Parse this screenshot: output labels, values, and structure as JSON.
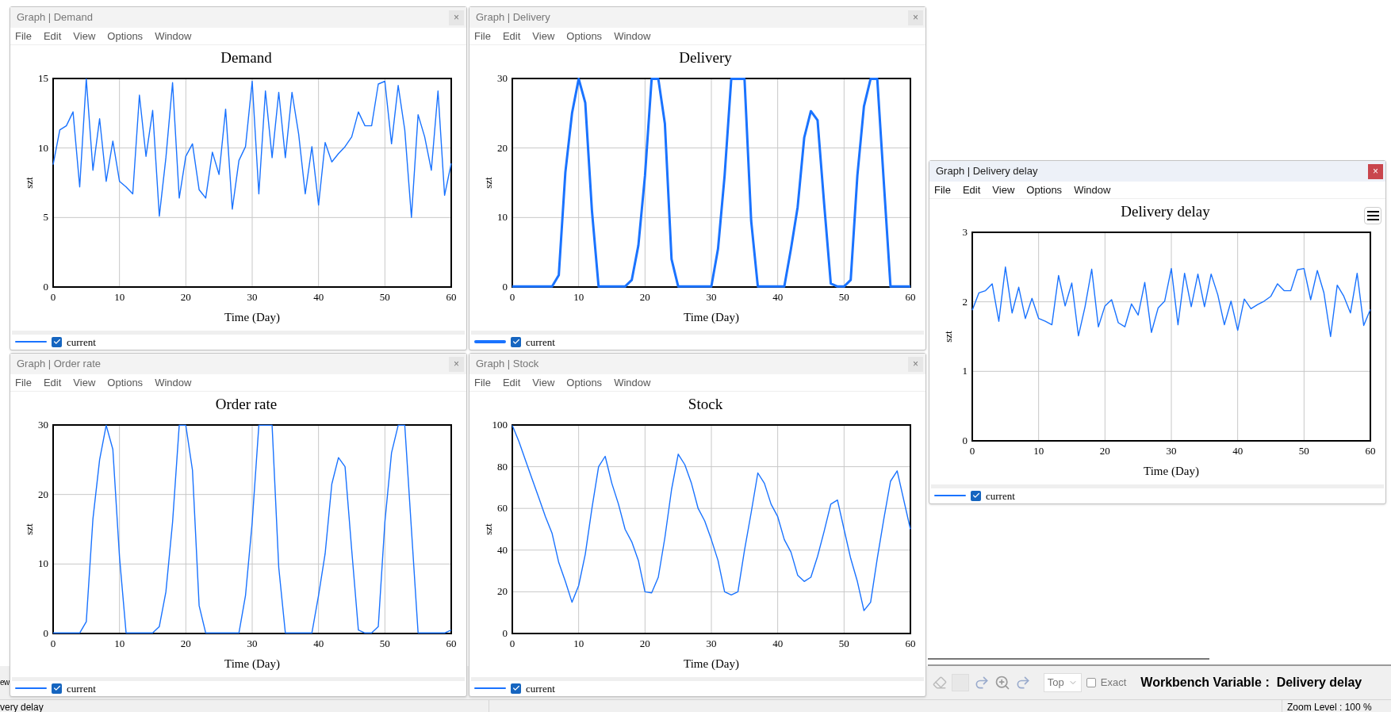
{
  "windows": [
    {
      "title": "Graph | Demand",
      "active": false,
      "close": "×",
      "menu": [
        "File",
        "Edit",
        "View",
        "Options",
        "Window"
      ],
      "thick_line": false,
      "chart_menu": false,
      "legend": {
        "checked": true
      },
      "chart_data": {
        "type": "line",
        "grid": true,
        "title": "Demand",
        "xlabel": "Time (Day)",
        "ylabel": "szt",
        "xlim": [
          0,
          60
        ],
        "ylim": [
          0,
          15
        ],
        "xticks": [
          0,
          10,
          20,
          30,
          40,
          50,
          60
        ],
        "yticks": [
          0,
          5,
          10,
          15
        ],
        "x": [
          0,
          1,
          2,
          3,
          4,
          5,
          6,
          7,
          8,
          9,
          10,
          11,
          12,
          13,
          14,
          15,
          16,
          17,
          18,
          19,
          20,
          21,
          22,
          23,
          24,
          25,
          26,
          27,
          28,
          29,
          30,
          31,
          32,
          33,
          34,
          35,
          36,
          37,
          38,
          39,
          40,
          41,
          42,
          43,
          44,
          45,
          46,
          47,
          48,
          49,
          50,
          51,
          52,
          53,
          54,
          55,
          56,
          57,
          58,
          59,
          60
        ],
        "series": [
          {
            "name": "current",
            "color": "#1a73ff",
            "values": [
              8.8,
              11.3,
              11.6,
              12.6,
              7.2,
              15,
              8.4,
              12.1,
              7.6,
              10.5,
              7.6,
              7.2,
              6.7,
              13.8,
              9.4,
              12.7,
              5.1,
              9.3,
              14.7,
              6.4,
              9.4,
              10.3,
              7.0,
              6.4,
              9.7,
              8.1,
              12.8,
              5.6,
              9.1,
              10.1,
              14.8,
              6.7,
              14.1,
              9.3,
              14.0,
              9.3,
              14.0,
              11.0,
              6.7,
              10.1,
              5.9,
              10.4,
              9.0,
              9.6,
              10.1,
              10.8,
              12.6,
              11.6,
              11.6,
              14.6,
              14.8,
              10.3,
              14.5,
              11.3,
              5.0,
              12.4,
              10.8,
              8.4,
              14.1,
              6.6,
              8.9
            ]
          }
        ]
      }
    },
    {
      "title": "Graph | Delivery",
      "active": false,
      "close": "×",
      "menu": [
        "File",
        "Edit",
        "View",
        "Options",
        "Window"
      ],
      "thick_line": true,
      "chart_menu": false,
      "legend": {
        "checked": true
      },
      "chart_data": {
        "type": "line",
        "grid": true,
        "title": "Delivery",
        "xlabel": "Time (Day)",
        "ylabel": "szt",
        "xlim": [
          0,
          60
        ],
        "ylim": [
          0,
          30
        ],
        "xticks": [
          0,
          10,
          20,
          30,
          40,
          50,
          60
        ],
        "yticks": [
          0,
          10,
          20,
          30
        ],
        "x": [
          0,
          1,
          2,
          3,
          4,
          5,
          6,
          7,
          8,
          9,
          10,
          11,
          12,
          13,
          14,
          15,
          16,
          17,
          18,
          19,
          20,
          21,
          22,
          23,
          24,
          25,
          26,
          27,
          28,
          29,
          30,
          31,
          32,
          33,
          34,
          35,
          36,
          37,
          38,
          39,
          40,
          41,
          42,
          43,
          44,
          45,
          46,
          47,
          48,
          49,
          50,
          51,
          52,
          53,
          54,
          55,
          56,
          57,
          58,
          59,
          60
        ],
        "series": [
          {
            "name": "current",
            "color": "#1a73ff",
            "values": [
              0,
              0,
              0,
              0,
              0,
              0,
              0,
              1.7,
              16.5,
              25,
              30,
              26.5,
              11,
              0,
              0,
              0,
              0,
              0,
              1,
              6,
              16,
              30,
              30,
              23.5,
              4,
              0,
              0,
              0,
              0,
              0,
              0,
              5.5,
              16,
              30,
              30,
              30,
              9.5,
              0,
              0,
              0,
              0,
              0,
              5.5,
              11.5,
              21.5,
              25.3,
              24,
              12,
              0.5,
              0,
              0,
              1,
              16,
              26,
              30,
              30,
              15,
              0,
              0,
              0,
              0
            ]
          }
        ]
      }
    },
    {
      "title": "Graph | Order rate",
      "active": false,
      "close": "×",
      "menu": [
        "File",
        "Edit",
        "View",
        "Options",
        "Window"
      ],
      "thick_line": false,
      "chart_menu": false,
      "legend": {
        "checked": true
      },
      "chart_data": {
        "type": "line",
        "grid": true,
        "title": "Order rate",
        "xlabel": "Time (Day)",
        "ylabel": "szt",
        "xlim": [
          0,
          60
        ],
        "ylim": [
          0,
          30
        ],
        "xticks": [
          0,
          10,
          20,
          30,
          40,
          50,
          60
        ],
        "yticks": [
          0,
          10,
          20,
          30
        ],
        "x": [
          0,
          1,
          2,
          3,
          4,
          5,
          6,
          7,
          8,
          9,
          10,
          11,
          12,
          13,
          14,
          15,
          16,
          17,
          18,
          19,
          20,
          21,
          22,
          23,
          24,
          25,
          26,
          27,
          28,
          29,
          30,
          31,
          32,
          33,
          34,
          35,
          36,
          37,
          38,
          39,
          40,
          41,
          42,
          43,
          44,
          45,
          46,
          47,
          48,
          49,
          50,
          51,
          52,
          53,
          54,
          55,
          56,
          57,
          58,
          59,
          60
        ],
        "series": [
          {
            "name": "current",
            "color": "#1a73ff",
            "values": [
              0,
              0,
              0,
              0,
              0,
              1.7,
              16.5,
              25,
              30,
              26.5,
              11,
              0,
              0,
              0,
              0,
              0,
              1,
              6,
              16,
              30,
              30,
              23.5,
              4,
              0,
              0,
              0,
              0,
              0,
              0,
              5.5,
              16,
              30,
              30,
              30,
              9.5,
              0,
              0,
              0,
              0,
              0,
              5.5,
              11.5,
              21.5,
              25.3,
              24,
              12,
              0.5,
              0,
              0,
              1,
              16,
              26,
              30,
              30,
              15,
              0,
              0,
              0,
              0,
              0,
              0.5
            ]
          }
        ]
      }
    },
    {
      "title": "Graph | Stock",
      "active": false,
      "close": "×",
      "menu": [
        "File",
        "Edit",
        "View",
        "Options",
        "Window"
      ],
      "thick_line": false,
      "chart_menu": false,
      "legend": {
        "checked": true
      },
      "chart_data": {
        "type": "line",
        "grid": true,
        "title": "Stock",
        "xlabel": "Time (Day)",
        "ylabel": "szt",
        "xlim": [
          0,
          60
        ],
        "ylim": [
          0,
          100
        ],
        "xticks": [
          0,
          10,
          20,
          30,
          40,
          50,
          60
        ],
        "yticks": [
          0,
          20,
          40,
          60,
          80,
          100
        ],
        "x": [
          0,
          1,
          2,
          3,
          4,
          5,
          6,
          7,
          8,
          9,
          10,
          11,
          12,
          13,
          14,
          15,
          16,
          17,
          18,
          19,
          20,
          21,
          22,
          23,
          24,
          25,
          26,
          27,
          28,
          29,
          30,
          31,
          32,
          33,
          34,
          35,
          36,
          37,
          38,
          39,
          40,
          41,
          42,
          43,
          44,
          45,
          46,
          47,
          48,
          49,
          50,
          51,
          52,
          53,
          54,
          55,
          56,
          57,
          58,
          59,
          60
        ],
        "series": [
          {
            "name": "current",
            "color": "#1a73ff",
            "values": [
              100,
              92,
              83,
              74,
              65,
              56,
              48,
              34,
              25,
              15,
              23,
              38,
              60,
              80,
              85,
              72,
              62,
              50,
              44,
              35,
              20,
              19.5,
              27,
              46,
              69,
              86,
              81,
              72,
              60,
              54,
              45,
              35,
              20,
              18.5,
              20,
              40,
              58,
              77,
              72,
              62,
              56,
              45,
              39,
              28,
              25,
              27,
              37,
              49,
              62,
              64,
              50,
              36,
              25,
              11,
              15,
              36,
              55,
              73,
              78,
              64,
              50
            ]
          }
        ]
      }
    },
    {
      "title": "Graph | Delivery delay",
      "active": true,
      "close": "×",
      "menu": [
        "File",
        "Edit",
        "View",
        "Options",
        "Window"
      ],
      "thick_line": false,
      "chart_menu": true,
      "legend": {
        "checked": true
      },
      "chart_data": {
        "type": "line",
        "grid": true,
        "title": "Delivery delay",
        "xlabel": "Time (Day)",
        "ylabel": "szt",
        "xlim": [
          0,
          60
        ],
        "ylim": [
          0,
          3
        ],
        "xticks": [
          0,
          10,
          20,
          30,
          40,
          50,
          60
        ],
        "yticks": [
          0,
          1,
          2,
          3
        ],
        "x": [
          0,
          1,
          2,
          3,
          4,
          5,
          6,
          7,
          8,
          9,
          10,
          11,
          12,
          13,
          14,
          15,
          16,
          17,
          18,
          19,
          20,
          21,
          22,
          23,
          24,
          25,
          26,
          27,
          28,
          29,
          30,
          31,
          32,
          33,
          34,
          35,
          36,
          37,
          38,
          39,
          40,
          41,
          42,
          43,
          44,
          45,
          46,
          47,
          48,
          49,
          50,
          51,
          52,
          53,
          54,
          55,
          56,
          57,
          58,
          59,
          60
        ],
        "series": [
          {
            "name": "current",
            "color": "#1a73ff",
            "values": [
              1.88,
              2.13,
              2.16,
              2.26,
              1.72,
              2.5,
              1.84,
              2.21,
              1.76,
              2.05,
              1.76,
              1.72,
              1.67,
              2.38,
              1.94,
              2.27,
              1.51,
              1.93,
              2.47,
              1.64,
              1.94,
              2.03,
              1.7,
              1.64,
              1.97,
              1.81,
              2.28,
              1.56,
              1.91,
              2.01,
              2.48,
              1.67,
              2.41,
              1.93,
              2.4,
              1.93,
              2.4,
              2.1,
              1.67,
              2.01,
              1.59,
              2.04,
              1.9,
              1.96,
              2.01,
              2.08,
              2.26,
              2.16,
              2.16,
              2.46,
              2.48,
              2.03,
              2.45,
              2.13,
              1.5,
              2.24,
              2.08,
              1.84,
              2.41,
              1.66,
              1.89
            ]
          }
        ]
      }
    }
  ],
  "toolbar": {
    "cut_label": "ew",
    "position_select": "Top",
    "exact": {
      "label": "Exact",
      "checked": false
    },
    "workbench": "Workbench Variable :  Delivery delay"
  },
  "status_bar": {
    "left": "very delay",
    "zoom": "Zoom Level : 100 %"
  }
}
